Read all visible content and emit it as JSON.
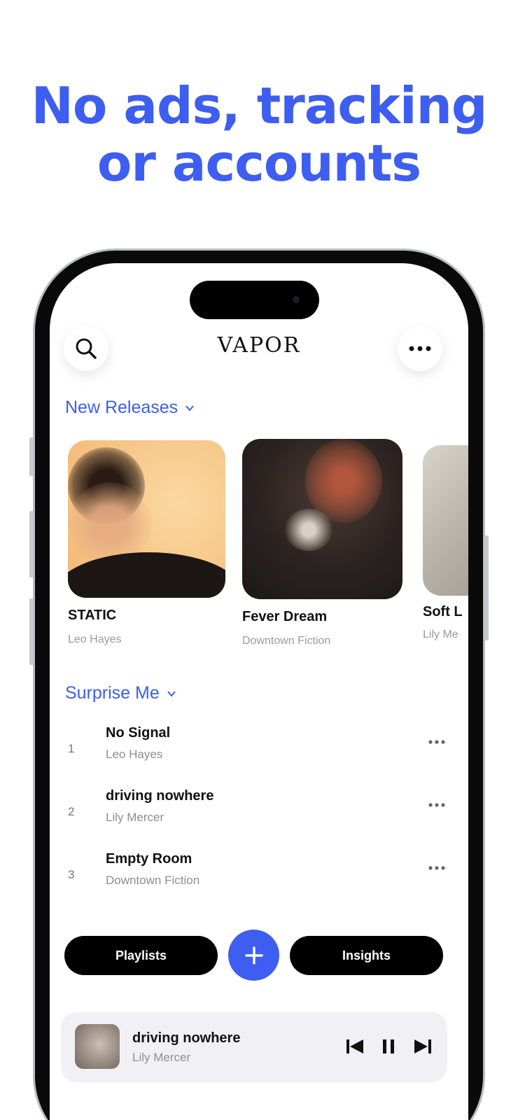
{
  "headline": {
    "line1": "No ads, tracking",
    "line2": "or accounts"
  },
  "app": {
    "logo": "VAPOR"
  },
  "icons": {
    "search": "search-icon",
    "more": "more-horizontal-icon"
  },
  "new_releases": {
    "title": "New Releases",
    "albums": [
      {
        "name": "STATIC",
        "artist": "Leo Hayes"
      },
      {
        "name": "Fever Dream",
        "artist": "Downtown Fiction"
      },
      {
        "name": "Soft L",
        "artist": "Lily Me"
      }
    ]
  },
  "surprise_me": {
    "title": "Surprise Me",
    "tracks": [
      {
        "num": "1",
        "title": "No Signal",
        "artist": "Leo Hayes"
      },
      {
        "num": "2",
        "title": "driving nowhere",
        "artist": "Lily Mercer"
      },
      {
        "num": "3",
        "title": "Empty Room",
        "artist": "Downtown Fiction"
      }
    ]
  },
  "actions": {
    "playlists": "Playlists",
    "insights": "Insights"
  },
  "now_playing": {
    "title": "driving nowhere",
    "artist": "Lily Mercer"
  },
  "colors": {
    "accent": "#3d5ef0",
    "pill": "#000000",
    "mini_player_bg": "#f1f1f5"
  }
}
